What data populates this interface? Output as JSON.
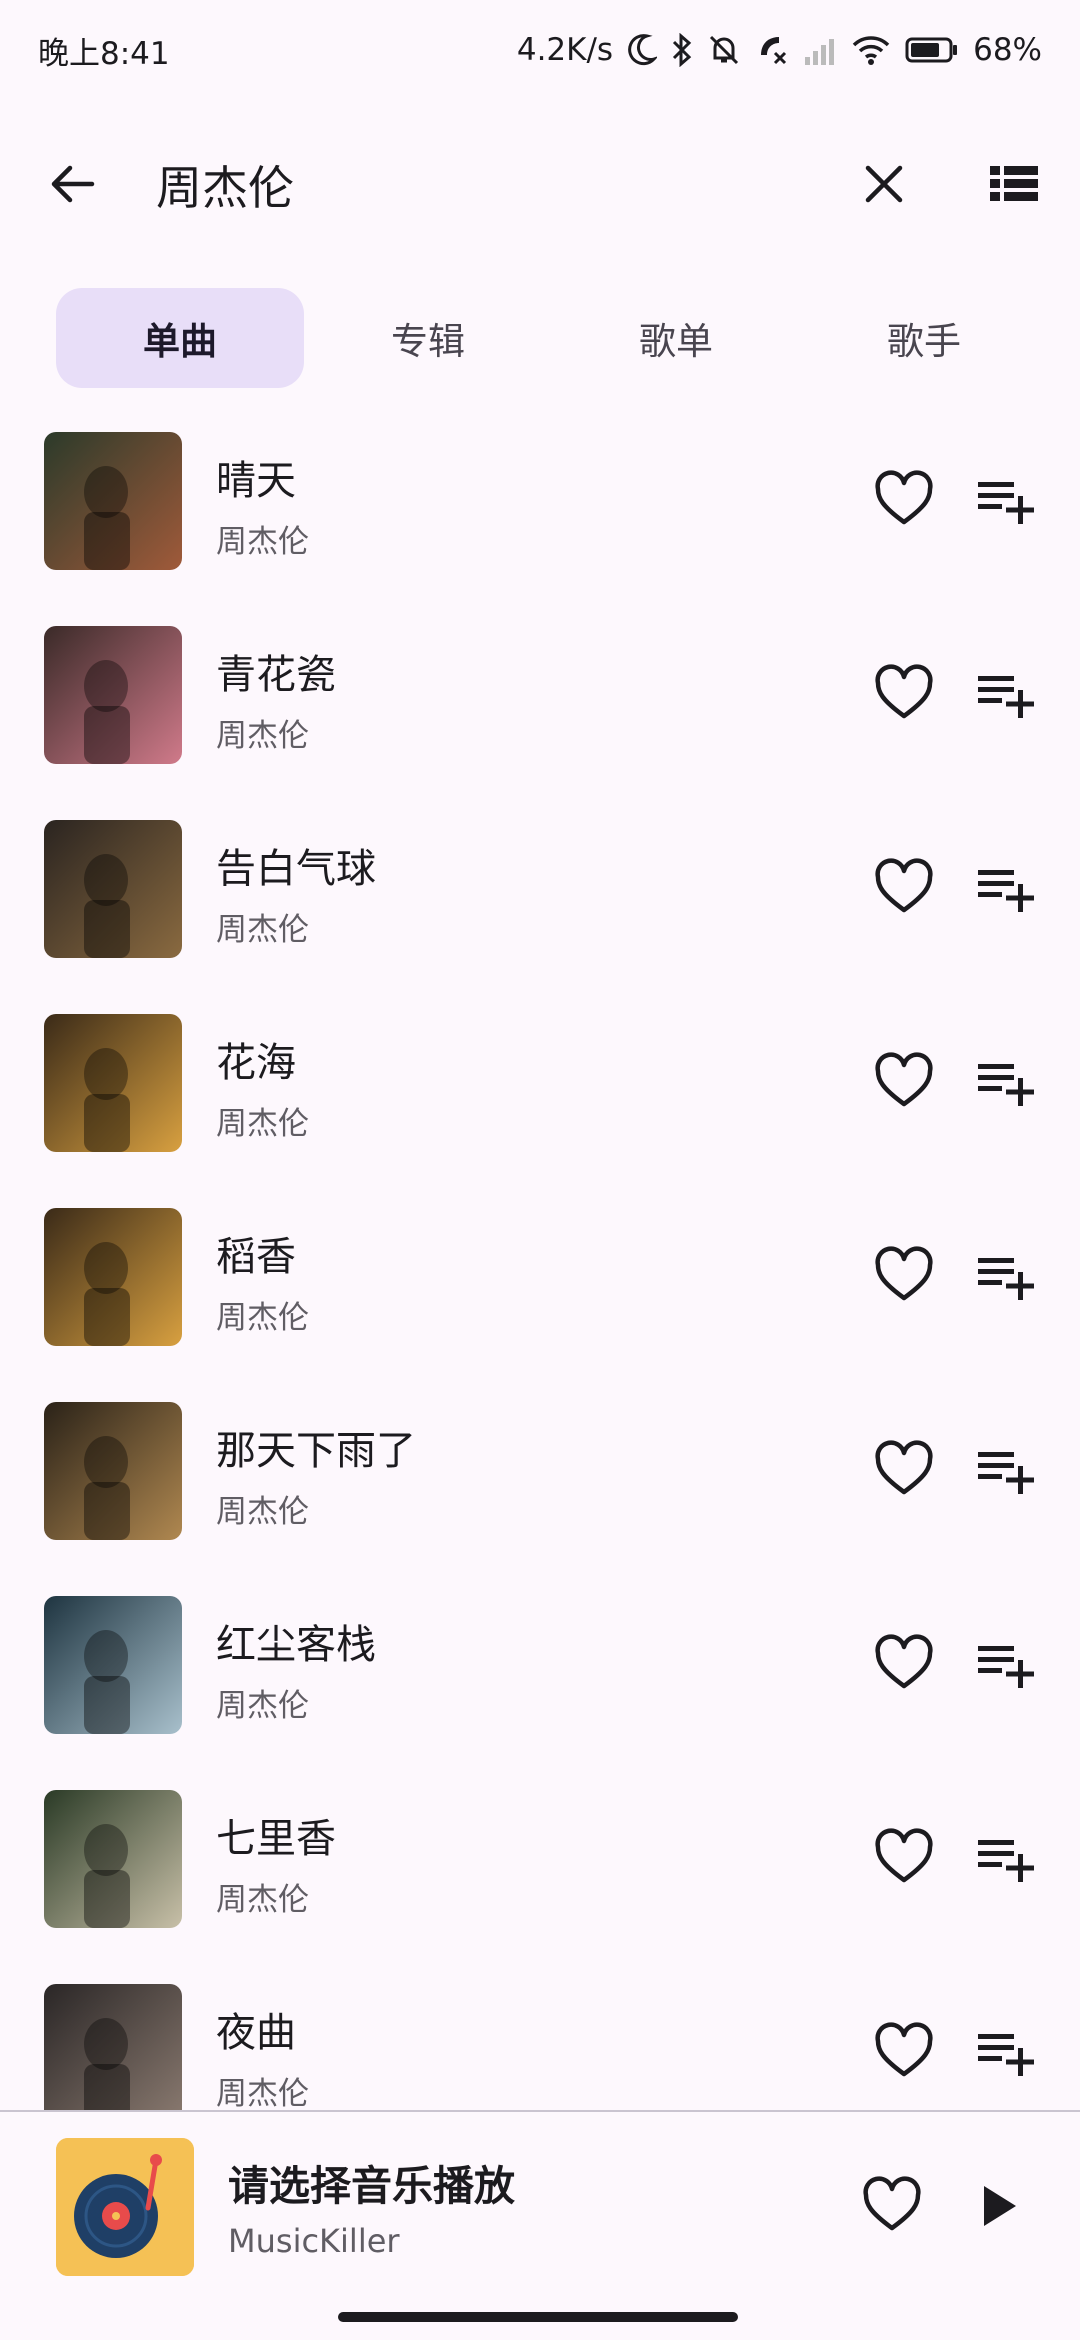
{
  "status": {
    "time": "晚上8:41",
    "speed": "4.2K/s",
    "battery": "68%"
  },
  "search": {
    "query": "周杰伦"
  },
  "tabs": [
    {
      "label": "单曲",
      "active": true
    },
    {
      "label": "专辑",
      "active": false
    },
    {
      "label": "歌单",
      "active": false
    },
    {
      "label": "歌手",
      "active": false
    }
  ],
  "songs": [
    {
      "title": "晴天",
      "artist": "周杰伦",
      "cover_colors": [
        "#2b3a2a",
        "#a05a3a"
      ]
    },
    {
      "title": "青花瓷",
      "artist": "周杰伦",
      "cover_colors": [
        "#3a2a28",
        "#d07a8a"
      ]
    },
    {
      "title": "告白气球",
      "artist": "周杰伦",
      "cover_colors": [
        "#2a2420",
        "#8a6a40"
      ]
    },
    {
      "title": "花海",
      "artist": "周杰伦",
      "cover_colors": [
        "#3a2a18",
        "#d8a040"
      ]
    },
    {
      "title": "稻香",
      "artist": "周杰伦",
      "cover_colors": [
        "#3a2a18",
        "#d8a040"
      ]
    },
    {
      "title": "那天下雨了",
      "artist": "周杰伦",
      "cover_colors": [
        "#2a2218",
        "#b08850"
      ]
    },
    {
      "title": "红尘客栈",
      "artist": "周杰伦",
      "cover_colors": [
        "#1e3440",
        "#a8c0cc"
      ]
    },
    {
      "title": "七里香",
      "artist": "周杰伦",
      "cover_colors": [
        "#2a3a26",
        "#c8c0a8"
      ]
    },
    {
      "title": "夜曲",
      "artist": "周杰伦",
      "cover_colors": [
        "#2a2626",
        "#8a7a70"
      ]
    }
  ],
  "player": {
    "title": "请选择音乐播放",
    "subtitle": "MusicKiller",
    "accent": "#f5c155"
  },
  "icons": {
    "back": "arrow-left-icon",
    "clear": "close-icon",
    "view": "list-view-icon",
    "favorite": "heart-outline-icon",
    "add": "playlist-add-icon",
    "play": "play-icon"
  }
}
